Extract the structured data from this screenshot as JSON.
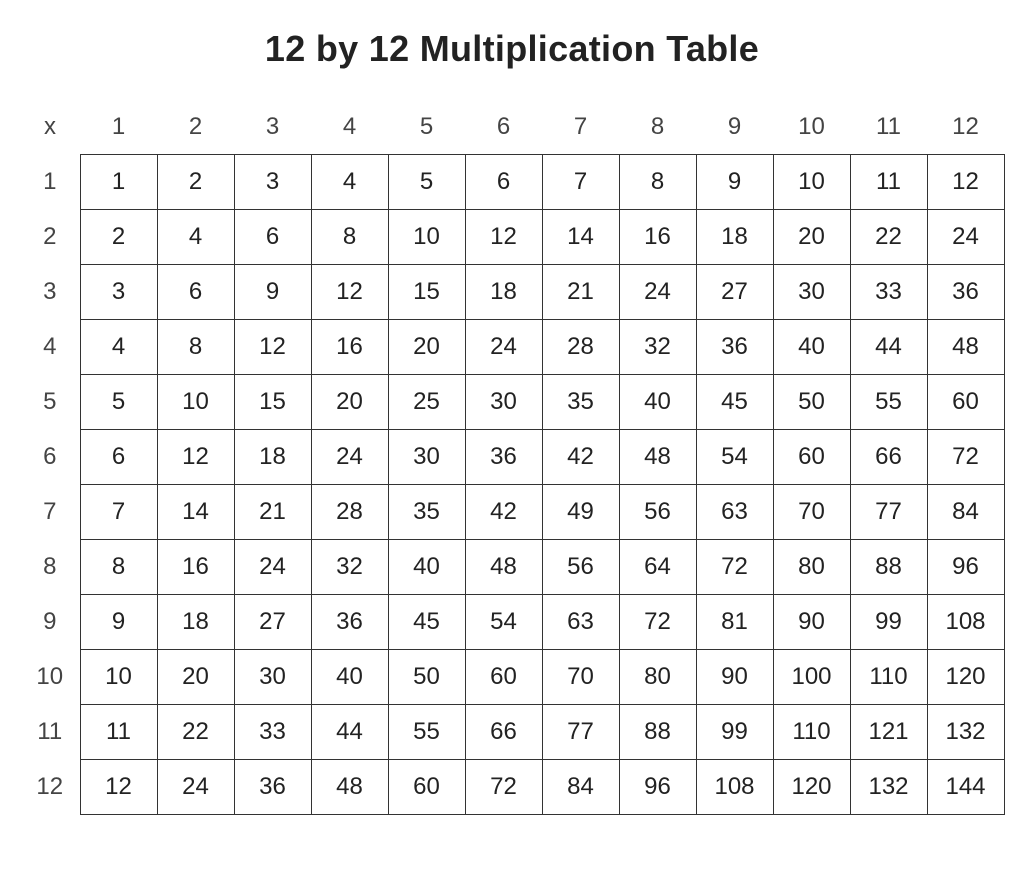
{
  "title": "12 by 12 Multiplication Table",
  "corner_label": "x",
  "columns": [
    "1",
    "2",
    "3",
    "4",
    "5",
    "6",
    "7",
    "8",
    "9",
    "10",
    "11",
    "12"
  ],
  "rows": [
    {
      "label": "1",
      "cells": [
        "1",
        "2",
        "3",
        "4",
        "5",
        "6",
        "7",
        "8",
        "9",
        "10",
        "11",
        "12"
      ]
    },
    {
      "label": "2",
      "cells": [
        "2",
        "4",
        "6",
        "8",
        "10",
        "12",
        "14",
        "16",
        "18",
        "20",
        "22",
        "24"
      ]
    },
    {
      "label": "3",
      "cells": [
        "3",
        "6",
        "9",
        "12",
        "15",
        "18",
        "21",
        "24",
        "27",
        "30",
        "33",
        "36"
      ]
    },
    {
      "label": "4",
      "cells": [
        "4",
        "8",
        "12",
        "16",
        "20",
        "24",
        "28",
        "32",
        "36",
        "40",
        "44",
        "48"
      ]
    },
    {
      "label": "5",
      "cells": [
        "5",
        "10",
        "15",
        "20",
        "25",
        "30",
        "35",
        "40",
        "45",
        "50",
        "55",
        "60"
      ]
    },
    {
      "label": "6",
      "cells": [
        "6",
        "12",
        "18",
        "24",
        "30",
        "36",
        "42",
        "48",
        "54",
        "60",
        "66",
        "72"
      ]
    },
    {
      "label": "7",
      "cells": [
        "7",
        "14",
        "21",
        "28",
        "35",
        "42",
        "49",
        "56",
        "63",
        "70",
        "77",
        "84"
      ]
    },
    {
      "label": "8",
      "cells": [
        "8",
        "16",
        "24",
        "32",
        "40",
        "48",
        "56",
        "64",
        "72",
        "80",
        "88",
        "96"
      ]
    },
    {
      "label": "9",
      "cells": [
        "9",
        "18",
        "27",
        "36",
        "45",
        "54",
        "63",
        "72",
        "81",
        "90",
        "99",
        "108"
      ]
    },
    {
      "label": "10",
      "cells": [
        "10",
        "20",
        "30",
        "40",
        "50",
        "60",
        "70",
        "80",
        "90",
        "100",
        "110",
        "120"
      ]
    },
    {
      "label": "11",
      "cells": [
        "11",
        "22",
        "33",
        "44",
        "55",
        "66",
        "77",
        "88",
        "99",
        "110",
        "121",
        "132"
      ]
    },
    {
      "label": "12",
      "cells": [
        "12",
        "24",
        "36",
        "48",
        "60",
        "72",
        "84",
        "96",
        "108",
        "120",
        "132",
        "144"
      ]
    }
  ],
  "chart_data": {
    "type": "table",
    "title": "12 by 12 Multiplication Table",
    "columns": [
      1,
      2,
      3,
      4,
      5,
      6,
      7,
      8,
      9,
      10,
      11,
      12
    ],
    "rows": [
      1,
      2,
      3,
      4,
      5,
      6,
      7,
      8,
      9,
      10,
      11,
      12
    ],
    "values": [
      [
        1,
        2,
        3,
        4,
        5,
        6,
        7,
        8,
        9,
        10,
        11,
        12
      ],
      [
        2,
        4,
        6,
        8,
        10,
        12,
        14,
        16,
        18,
        20,
        22,
        24
      ],
      [
        3,
        6,
        9,
        12,
        15,
        18,
        21,
        24,
        27,
        30,
        33,
        36
      ],
      [
        4,
        8,
        12,
        16,
        20,
        24,
        28,
        32,
        36,
        40,
        44,
        48
      ],
      [
        5,
        10,
        15,
        20,
        25,
        30,
        35,
        40,
        45,
        50,
        55,
        60
      ],
      [
        6,
        12,
        18,
        24,
        30,
        36,
        42,
        48,
        54,
        60,
        66,
        72
      ],
      [
        7,
        14,
        21,
        28,
        35,
        42,
        49,
        56,
        63,
        70,
        77,
        84
      ],
      [
        8,
        16,
        24,
        32,
        40,
        48,
        56,
        64,
        72,
        80,
        88,
        96
      ],
      [
        9,
        18,
        27,
        36,
        45,
        54,
        63,
        72,
        81,
        90,
        99,
        108
      ],
      [
        10,
        20,
        30,
        40,
        50,
        60,
        70,
        80,
        90,
        100,
        110,
        120
      ],
      [
        11,
        22,
        33,
        44,
        55,
        66,
        77,
        88,
        99,
        110,
        121,
        132
      ],
      [
        12,
        24,
        36,
        48,
        60,
        72,
        84,
        96,
        108,
        120,
        132,
        144
      ]
    ]
  }
}
